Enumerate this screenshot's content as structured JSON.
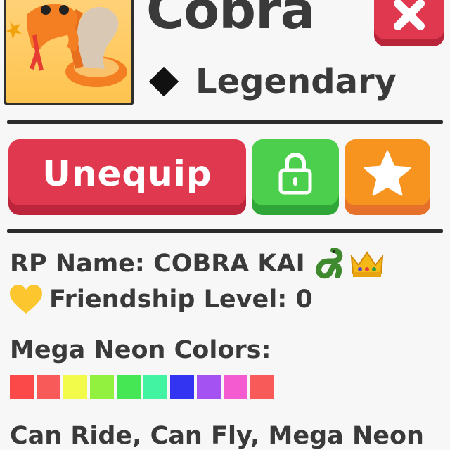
{
  "pet": {
    "name": "Cobra",
    "rarity": "Legendary"
  },
  "actions": {
    "unequip_label": "Unequip"
  },
  "details": {
    "rp_name": "RP Name: COBRA KAI",
    "friendship": "Friendship Level: 0",
    "colors_heading": "Mega Neon Colors:",
    "abilities": "Can Ride, Can Fly, Mega Neon"
  },
  "mega_neon_colors": [
    "#fb4848",
    "#f85a5a",
    "#f3fb4a",
    "#92f13f",
    "#45e854",
    "#42f3a1",
    "#3333f2",
    "#a452f2",
    "#f45bd0",
    "#f85a5a"
  ],
  "colors": {
    "close": "#e0384e",
    "unequip": "#e0394f",
    "lock": "#4ccf4d",
    "favorite": "#f7931f"
  },
  "icons": {
    "rarity": "diamond-icon",
    "close": "close-icon",
    "lock": "lock-icon",
    "favorite": "star-icon",
    "rp_emoji_1": "snake-emoji-icon",
    "rp_emoji_2": "crown-emoji-icon",
    "friendship": "heart-icon"
  }
}
